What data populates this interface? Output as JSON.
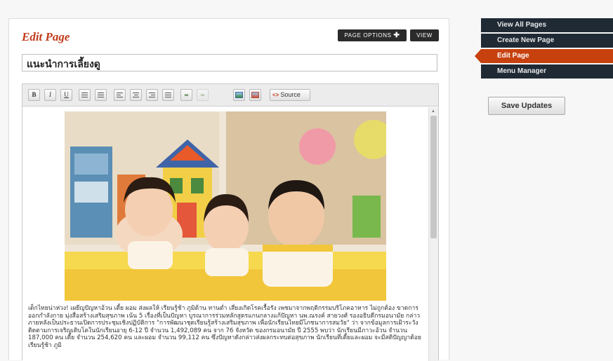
{
  "editor": {
    "heading": "Edit Page",
    "page_options_label": "PAGE OPTIONS",
    "page_options_symbol": "✚",
    "view_label": "VIEW",
    "title_value": "แนะนำการเลี้ยงดู",
    "toolbar": {
      "bold": "B",
      "italic": "I",
      "underline": "U",
      "source_label": "Source"
    },
    "body_text": "เด็กไทยน่าห่วง! เผยีญปัญหาอ้วน เตี้ย ผอม ส่งผลให้ เรียนรู้ช้า ภูมิต้าน ทานต่ำ เสี่ยงเกิดโรคเรื้อรัง เพชมาจากพฤติกรรมบริโภคอาหาร ไม่ถูกต้อง ขาดการออกกำลังกาย มุ่งสื่อสร้างเสริมสุขภาพ เน้น 5 เรื่องที่เป็นปัญหา บูรณาการร่วมหลักสูตรแกนกลางแก้ปัญหา นพ.ณรงค์ สายวงศ์ รองอธิบดีกรมอนามัย กล่าวภายหลังเป็นประธานเปิดการประชุมเชิงปฏิบัติการ \"การพัฒนาชุดเรียนรู้สร้างเสริมสุขภาพ เพื่อนักเรียนไทยมีโภชนาการสมวัย\" ว่า จากข้อมูลการเฝ้าระวังติดตามการเจริญเติบโตในนักเรียนอายุ 6-12 ปี จำนวน 1,492,089 คน จาก 76 จังหวัด ของกรมอนามัย ปี 2555 พบว่า นักเรียนมีภาวะอ้วน จำนวน 187,000 คน เตี้ย จำนวน 254,620 คน และผอม จำนวน 99,112 คน ซึ่งปัญหาดังกล่าวส่งผลกระทบต่อสุขภาพ นักเรียนที่เตี้ยและผอม จะมีสติปัญญาด้อย เรียนรู้ช้า ภูมิ"
  },
  "sidebar": {
    "items": [
      {
        "label": "View All Pages"
      },
      {
        "label": "Create New Page"
      },
      {
        "label": "Edit Page"
      },
      {
        "label": "Menu Manager"
      }
    ],
    "save_label": "Save Updates"
  },
  "colors": {
    "accent": "#c7410f",
    "heading": "#c23b1b",
    "nav_bg": "#1f2a35"
  }
}
